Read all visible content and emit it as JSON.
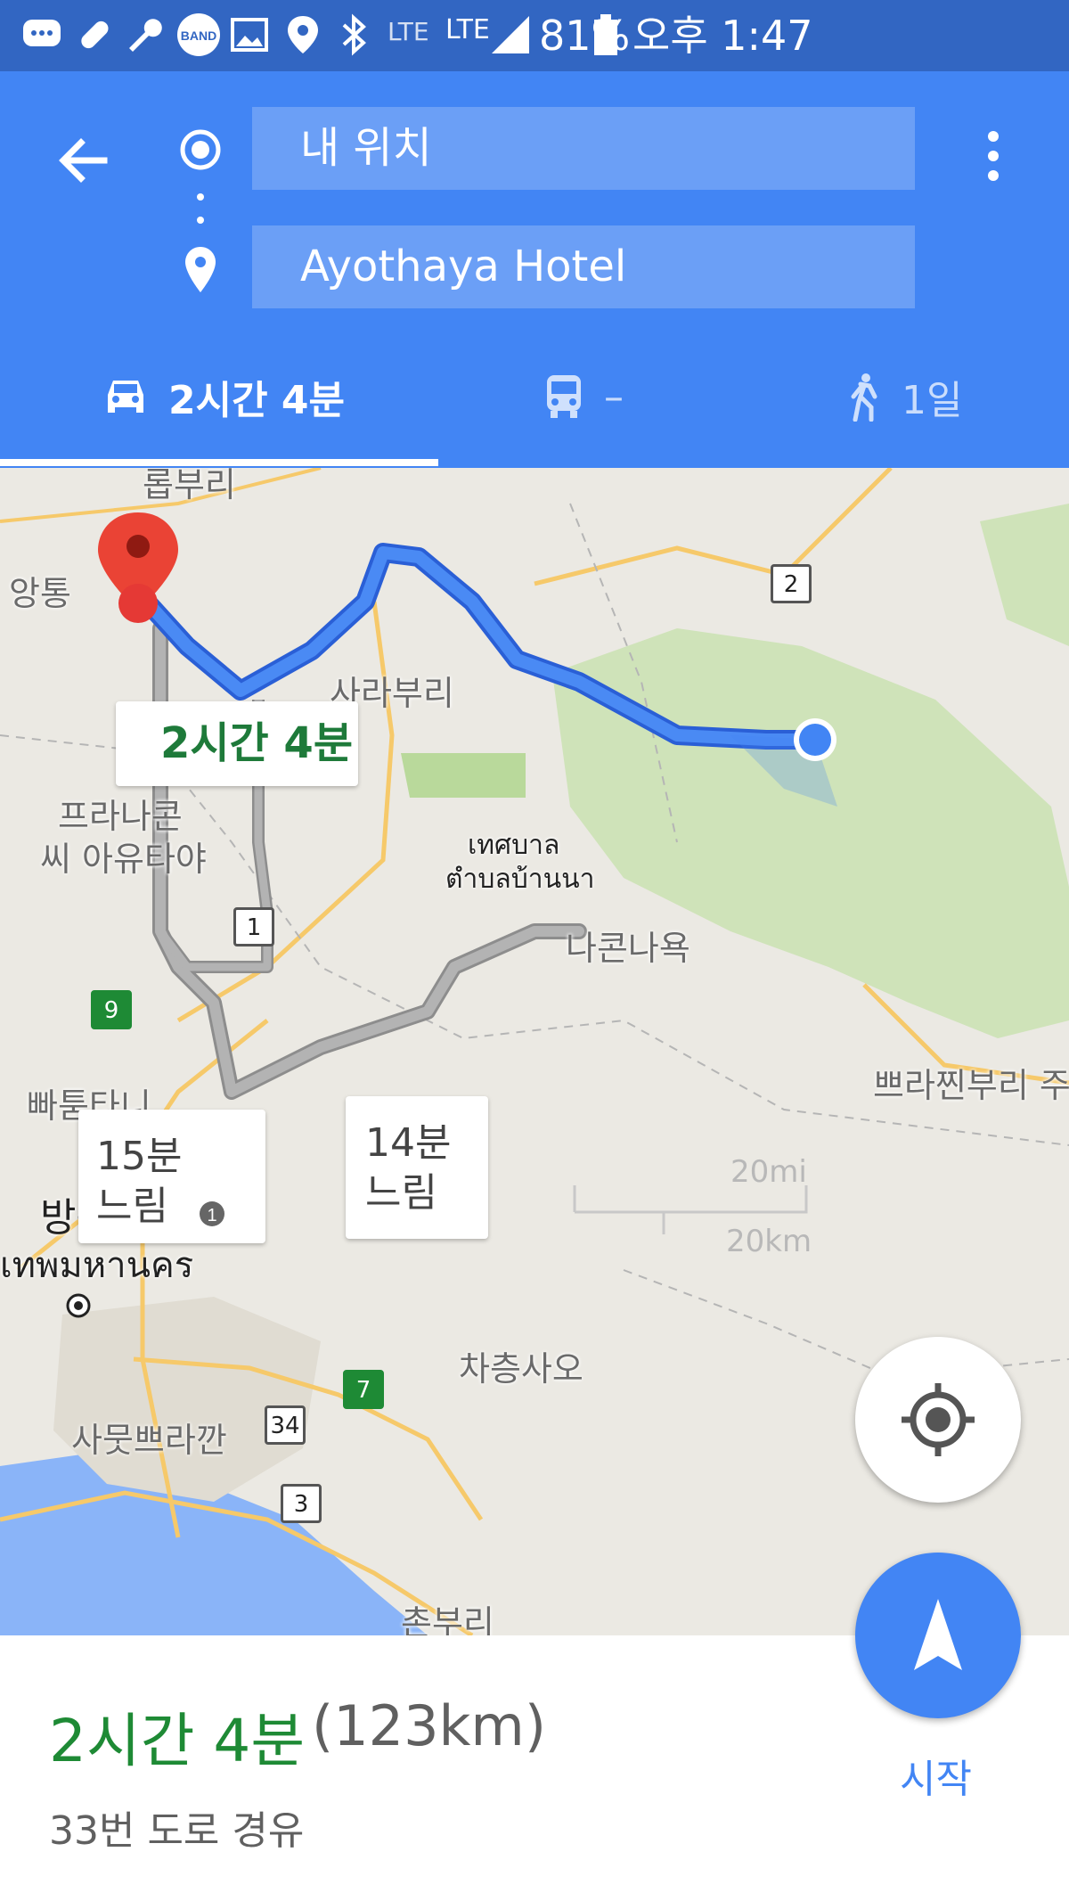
{
  "status_bar": {
    "battery": "81%",
    "time": "오후 1:47",
    "network_1": "LTE",
    "network_2": "LTE",
    "icons": [
      "chat-icon",
      "pill-icon",
      "wrench-icon",
      "band-icon",
      "image-icon",
      "location-icon",
      "bluetooth-icon",
      "signal-icon",
      "battery-icon"
    ],
    "band_text": "BAND"
  },
  "header": {
    "origin": "내 위치",
    "destination": "Ayothaya Hotel",
    "modes": [
      {
        "icon": "car-icon",
        "label": "2시간 4분",
        "selected": true
      },
      {
        "icon": "transit-icon",
        "label": "–",
        "selected": false
      },
      {
        "icon": "walk-icon",
        "label": "1일",
        "selected": false
      }
    ]
  },
  "map": {
    "places": {
      "p1": "앙통",
      "p2": "사라부리",
      "p3": "프라나콘",
      "p4": "씨 아유타야",
      "p5": "เทศบาล",
      "p6": "ตำบลบ้านนา",
      "p7": "나콘나욕",
      "p8": "쁘라찐부리 주",
      "p9": "빠툼타니",
      "p10": "방콕",
      "p11": "เทพมหานคร",
      "p12": "차층사오",
      "p13": "사뭇쁘라깐",
      "p14": "촌부리",
      "p15": "롭부리"
    },
    "route_badges": {
      "r1": "1",
      "r2": "2",
      "r3": "3",
      "r7": "7",
      "r9": "9",
      "r34": "34"
    },
    "main_callout": "2시간 4분",
    "alt_callout_1": {
      "line1": "15분",
      "line2": "느림"
    },
    "alt_callout_2": {
      "line1": "14분",
      "line2": "느림"
    },
    "scale": {
      "mi": "20mi",
      "km": "20km"
    },
    "accent_route": "#4285f4",
    "alt_route": "#9e9e9e"
  },
  "summary": {
    "duration": "2시간 4분",
    "distance": "(123km)",
    "via": "33번 도로 경유",
    "start_label": "시작"
  },
  "colors": {
    "primary": "#4285f4",
    "status_bar": "#3266c2",
    "duration_green": "#1e8a35"
  }
}
